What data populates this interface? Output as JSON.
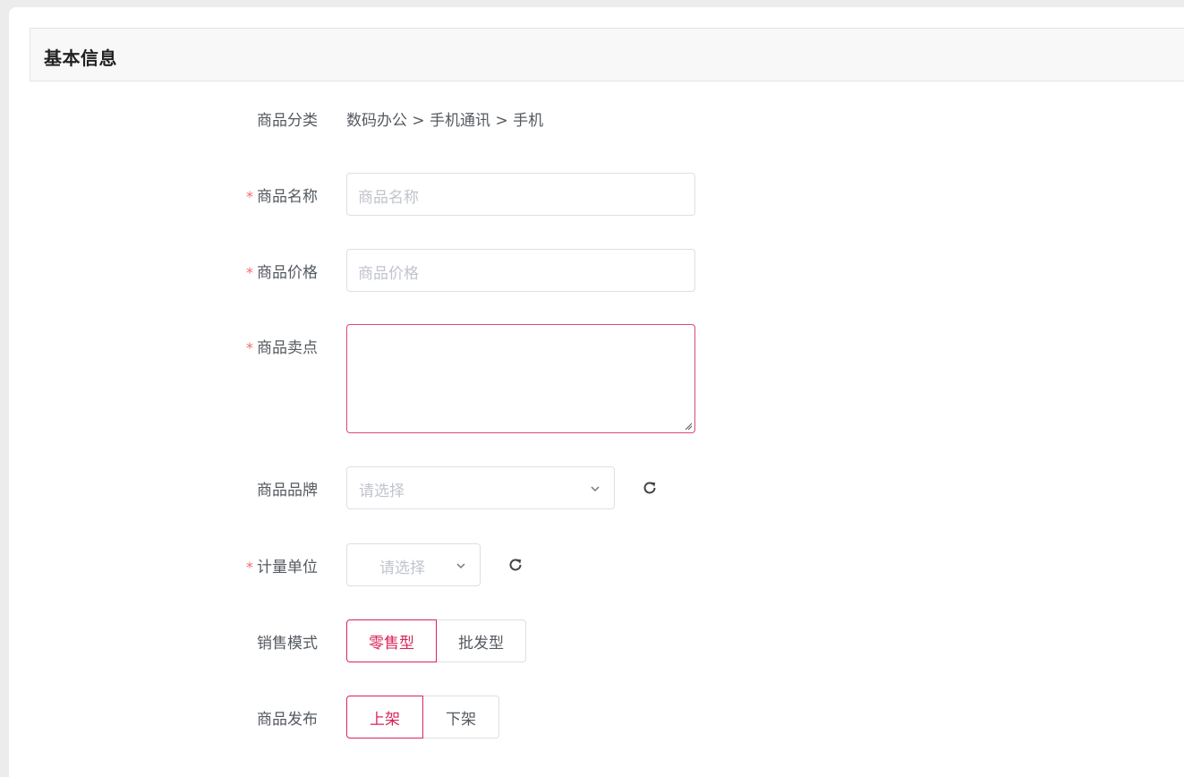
{
  "section": {
    "title": "基本信息"
  },
  "form": {
    "category": {
      "label": "商品分类",
      "value": "数码办公 > 手机通讯 > 手机"
    },
    "name": {
      "label": "商品名称",
      "required": "*",
      "placeholder": "商品名称",
      "value": ""
    },
    "price": {
      "label": "商品价格",
      "required": "*",
      "placeholder": "商品价格",
      "value": ""
    },
    "selling_point": {
      "label": "商品卖点",
      "required": "*",
      "value": ""
    },
    "brand": {
      "label": "商品品牌",
      "placeholder": "请选择",
      "refresh_icon": "refresh-icon"
    },
    "unit": {
      "label": "计量单位",
      "required": "*",
      "placeholder": "请选择",
      "refresh_icon": "refresh-icon"
    },
    "sales_mode": {
      "label": "销售模式",
      "options": [
        "零售型",
        "批发型"
      ],
      "selected": "零售型"
    },
    "publish": {
      "label": "商品发布",
      "options": [
        "上架",
        "下架"
      ],
      "selected": "上架"
    }
  },
  "colors": {
    "accent": "#d9245a",
    "required": "#f56c6c",
    "border": "#dcdfe6",
    "placeholder": "#c0c4cc"
  }
}
